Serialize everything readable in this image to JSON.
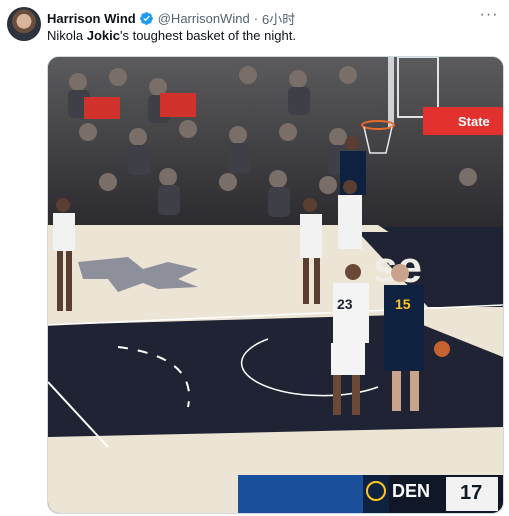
{
  "tweet": {
    "author_name": "Harrison Wind",
    "author_handle": "@HarrisonWind",
    "separator": "·",
    "timestamp": "6小时",
    "more_label": "···",
    "text_before": "Nikola ",
    "text_bold": "Jokic",
    "text_after": "'s toughest basket of the night."
  },
  "media": {
    "sponsor_sign": "State",
    "court_floor_text": "se",
    "score_team": "DEN",
    "score_value": "17",
    "jersey_numbers": [
      "23",
      "15"
    ]
  },
  "colors": {
    "verified": "#1d9bf0",
    "nuggets_navy": "#0e2240",
    "court_light": "#ece4d4",
    "court_dark": "#1f2333"
  }
}
